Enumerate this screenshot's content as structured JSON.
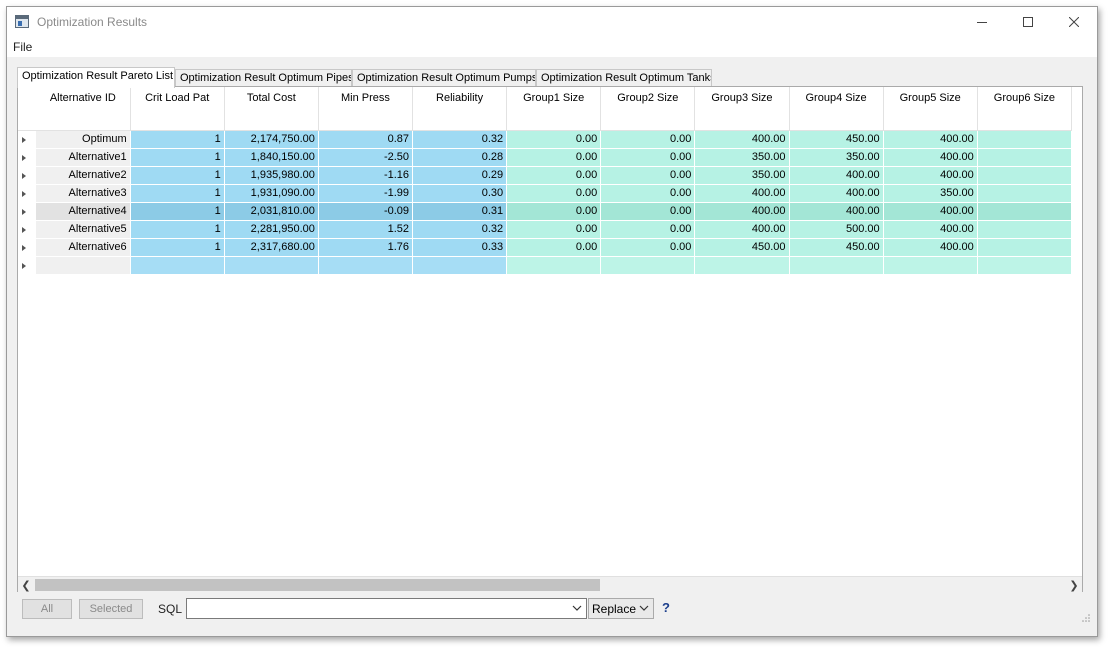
{
  "window": {
    "title": "Optimization Results",
    "icon": "app-window-icon",
    "controls": [
      "minimize-icon",
      "maximize-icon",
      "close-icon"
    ]
  },
  "menu": {
    "file": "File"
  },
  "tabs": [
    {
      "label": "Optimization Result Pareto List",
      "active": true
    },
    {
      "label": "Optimization Result Optimum Pipes",
      "active": false
    },
    {
      "label": "Optimization Result Optimum Pumps",
      "active": false
    },
    {
      "label": "Optimization Result Optimum Tanks",
      "active": false
    }
  ],
  "grid": {
    "columns": [
      "Alternative ID",
      "Crit Load Pat",
      "Total Cost",
      "Min Press",
      "Reliability",
      "Group1 Size",
      "Group2 Size",
      "Group3 Size",
      "Group4 Size",
      "Group5 Size",
      "Group6 Size"
    ],
    "rows": [
      [
        "Optimum",
        "1",
        "2,174,750.00",
        "0.87",
        "0.32",
        "0.00",
        "0.00",
        "400.00",
        "450.00",
        "400.00",
        ""
      ],
      [
        "Alternative1",
        "1",
        "1,840,150.00",
        "-2.50",
        "0.28",
        "0.00",
        "0.00",
        "350.00",
        "350.00",
        "400.00",
        ""
      ],
      [
        "Alternative2",
        "1",
        "1,935,980.00",
        "-1.16",
        "0.29",
        "0.00",
        "0.00",
        "350.00",
        "400.00",
        "400.00",
        ""
      ],
      [
        "Alternative3",
        "1",
        "1,931,090.00",
        "-1.99",
        "0.30",
        "0.00",
        "0.00",
        "400.00",
        "400.00",
        "350.00",
        ""
      ],
      [
        "Alternative4",
        "1",
        "2,031,810.00",
        "-0.09",
        "0.31",
        "0.00",
        "0.00",
        "400.00",
        "400.00",
        "400.00",
        ""
      ],
      [
        "Alternative5",
        "1",
        "2,281,950.00",
        "1.52",
        "0.32",
        "0.00",
        "0.00",
        "400.00",
        "500.00",
        "400.00",
        ""
      ],
      [
        "Alternative6",
        "1",
        "2,317,680.00",
        "1.76",
        "0.33",
        "0.00",
        "0.00",
        "450.00",
        "450.00",
        "400.00",
        ""
      ]
    ],
    "selected_row": 4
  },
  "bottom": {
    "all_label": "All",
    "selected_label": "Selected",
    "sql_label": "SQL",
    "sql_value": "",
    "replace_label": "Replace",
    "help_label": "?"
  },
  "colors": {
    "blue_cell": "#9fdaf3",
    "mint_cell": "#b6f2e4",
    "id_cell": "#f0f0f0"
  }
}
